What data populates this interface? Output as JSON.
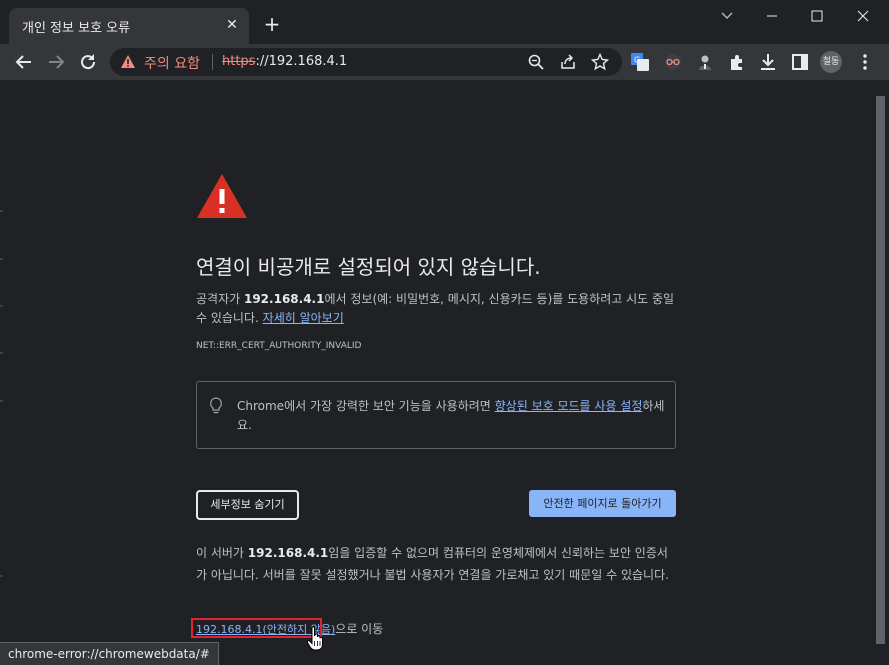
{
  "tab": {
    "title": "개인 정보 보호 오류"
  },
  "omnibox": {
    "security_label": "주의 요함",
    "url_scheme": "https",
    "url_rest": "://192.168.4.1"
  },
  "profile": {
    "initials": "철동"
  },
  "page": {
    "heading": "연결이 비공개로 설정되어 있지 않습니다.",
    "desc_pre": "공격자가 ",
    "desc_host": "192.168.4.1",
    "desc_post": "에서 정보(예: 비밀번호, 메시지, 신용카드 등)를 도용하려고 시도 중일 수 있습니다. ",
    "learn_more": "자세히 알아보기",
    "error_code": "NET::ERR_CERT_AUTHORITY_INVALID",
    "tip_pre": "Chrome에서 가장 강력한 보안 기능을 사용하려면 ",
    "tip_link": "향상된 보호 모드를 사용 설정",
    "tip_post": "하세요.",
    "hide_details_button": "세부정보 숨기기",
    "back_button": "안전한 페이지로 돌아가기",
    "details_pre": "이 서버가 ",
    "details_host": "192.168.4.1",
    "details_post": "임을 입증할 수 없으며 컴퓨터의 운영체제에서 신뢰하는 보안 인증서가 아닙니다. 서버를 잘못 설정했거나 불법 사용자가 연결을 가로채고 있기 때문일 수 있습니다.",
    "proceed_link": "192.168.4.1(안전하지 않음)",
    "proceed_suffix": "으로 이동"
  },
  "status_bar": {
    "text": "chrome-error://chromewebdata/#"
  },
  "colors": {
    "background": "#202124",
    "chrome": "#35363a",
    "warning": "#d93025",
    "link": "#8ab4f8",
    "highlight_box": "#e0242b"
  },
  "icons": [
    "close-icon",
    "plus-icon",
    "minimize-icon",
    "maximize-icon",
    "back-icon",
    "forward-icon",
    "reload-icon",
    "warning-icon",
    "zoom-icon",
    "share-icon",
    "star-icon",
    "translate-icon",
    "extension-icon",
    "puzzle-icon",
    "download-icon",
    "side-panel-icon",
    "menu-icon",
    "lightbulb-icon",
    "cursor-icon"
  ]
}
